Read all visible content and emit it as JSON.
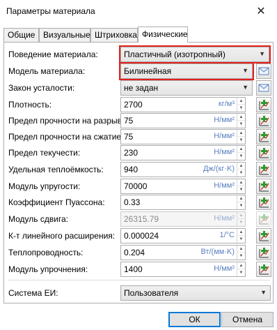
{
  "window": {
    "title": "Параметры материала",
    "close_glyph": "✕"
  },
  "tabs": [
    {
      "label": "Общие"
    },
    {
      "label": "Визуальные"
    },
    {
      "label": "Штриховка"
    },
    {
      "label": "Физические",
      "active": true
    }
  ],
  "form": {
    "material_behavior": {
      "label": "Поведение материала:",
      "value": "Пластичный (изотропный)"
    },
    "material_model": {
      "label": "Модель материала:",
      "value": "Билинейная"
    },
    "fatigue_law": {
      "label": "Закон усталости:",
      "value": "не задан"
    },
    "fields": [
      {
        "label": "Плотность:",
        "value": "2700",
        "unit": "кг/м³"
      },
      {
        "label": "Предел прочности на разрыв:",
        "value": "75",
        "unit": "Н/мм²"
      },
      {
        "label": "Предел прочности на сжатие:",
        "value": "75",
        "unit": "Н/мм²"
      },
      {
        "label": "Предел текучести:",
        "value": "230",
        "unit": "Н/мм²"
      },
      {
        "label": "Удельная теплоёмкость:",
        "value": "940",
        "unit": "Дж/(кг·K)"
      },
      {
        "label": "Модуль упругости:",
        "value": "70000",
        "unit": "Н/мм²"
      },
      {
        "label": "Коэффициент Пуассона:",
        "value": "0.33",
        "unit": ""
      },
      {
        "label": "Модуль сдвига:",
        "value": "26315.79",
        "unit": "Н/мм²",
        "disabled": true
      },
      {
        "label": "К-т линейного расширения:",
        "value": "0.000024",
        "unit": "1/°C"
      },
      {
        "label": "Теплопроводность:",
        "value": "0.204",
        "unit": "Вт/(мм·K)"
      },
      {
        "label": "Модуль упрочнения:",
        "value": "1400",
        "unit": "Н/мм²"
      }
    ],
    "units_system": {
      "label": "Система ЕИ:",
      "value": "Пользователя"
    }
  },
  "buttons": {
    "ok": "ОК",
    "cancel": "Отмена"
  },
  "colors": {
    "highlight": "#e3211c",
    "unit_text": "#5a7fbf",
    "accent": "#0078d7"
  },
  "icons": {
    "library": "library-icon",
    "add_dependency": "add-dependency-icon"
  }
}
